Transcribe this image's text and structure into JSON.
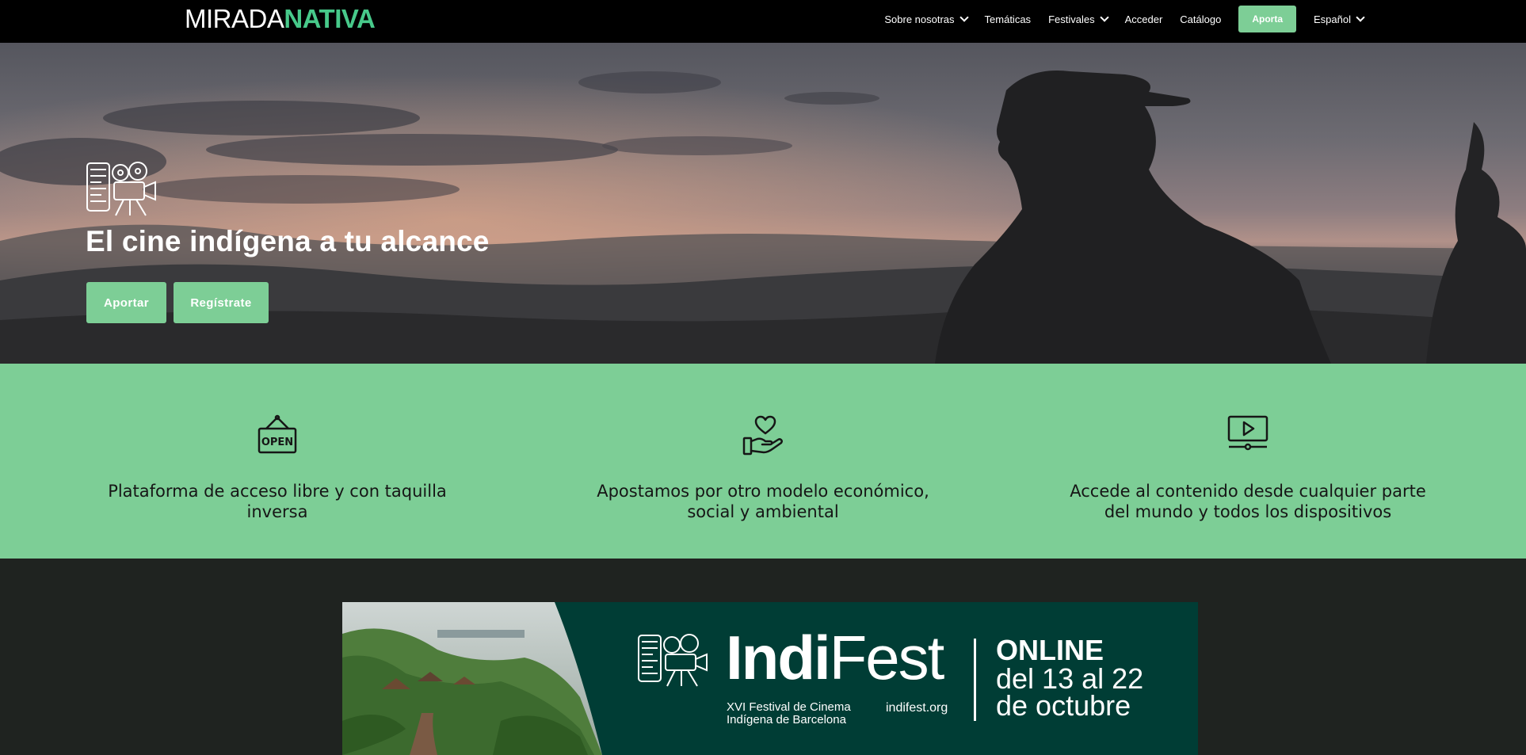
{
  "header": {
    "logo_part1": "MIRADA",
    "logo_part2": "NATIVA",
    "nav": {
      "about": "Sobre nosotras",
      "topics": "Temáticas",
      "festivals": "Festivales",
      "login": "Acceder",
      "catalog": "Catálogo",
      "contribute": "Aporta",
      "language": "Español"
    }
  },
  "hero": {
    "title": "El cine indígena a tu alcance",
    "btn_contribute": "Aportar",
    "btn_register": "Regístrate"
  },
  "features": [
    {
      "icon": "open-sign-icon",
      "text": "Plataforma de acceso libre y con taquilla inversa"
    },
    {
      "icon": "heart-hand-icon",
      "text": "Apostamos por otro modelo económico, social y ambiental"
    },
    {
      "icon": "video-player-icon",
      "text": "Accede al contenido desde cualquier parte del mundo y todos los dispositivos"
    }
  ],
  "banner": {
    "brand_bold": "Indi",
    "brand_light": "Fest",
    "subtitle_line1": "XVI Festival de Cinema",
    "subtitle_line2": "Indígena de Barcelona",
    "url": "indifest.org",
    "online": "ONLINE",
    "dates_line1": "del 13 al 22",
    "dates_line2": "de octubre",
    "open_sign_text": "OPEN"
  },
  "colors": {
    "accent": "#7dce96",
    "logo_green": "#47c98a",
    "banner_bg": "#003d35",
    "dark_bg": "#1f2320",
    "navbar_bg": "#000000"
  }
}
